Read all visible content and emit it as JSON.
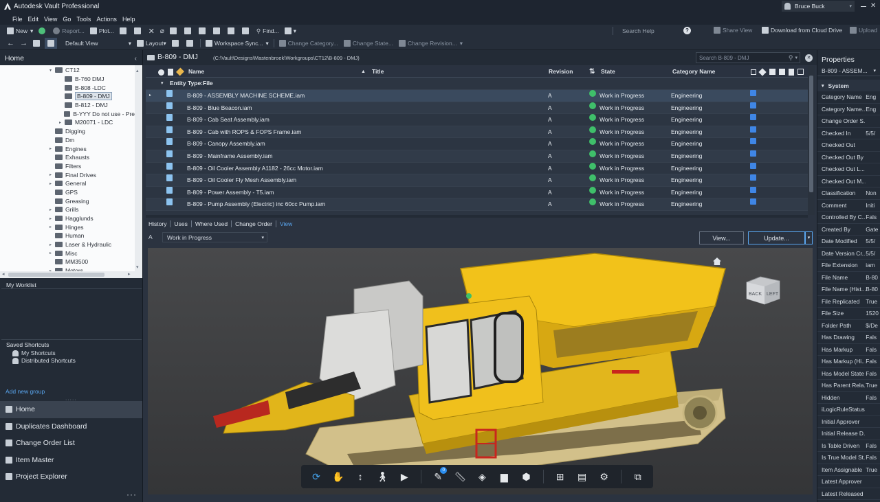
{
  "app": {
    "title": "Autodesk Vault Professional",
    "user": "Bruce Buck"
  },
  "menu": [
    "File",
    "Edit",
    "View",
    "Go",
    "Tools",
    "Actions",
    "Help"
  ],
  "toolbar1": {
    "new": "New",
    "report": "Report...",
    "plot": "Plot...",
    "find": "Find...",
    "search_help": "Search Help",
    "share_view": "Share View",
    "download_cloud": "Download from Cloud Drive",
    "upload": "Upload"
  },
  "toolbar2": {
    "default_view": "Default View",
    "layout": "Layout",
    "workspace_sync": "Workspace Sync...",
    "change_category": "Change Category...",
    "change_state": "Change State...",
    "change_revision": "Change Revision..."
  },
  "left": {
    "home": "Home",
    "tree": [
      {
        "label": "CT12",
        "level": 1,
        "expander": "▾"
      },
      {
        "label": "B-760 DMJ",
        "level": 2,
        "expander": ""
      },
      {
        "label": "B-808 -LDC",
        "level": 2,
        "expander": ""
      },
      {
        "label": "B-809 - DMJ",
        "level": 2,
        "expander": "",
        "selected": true
      },
      {
        "label": "B-812 - DMJ",
        "level": 2,
        "expander": ""
      },
      {
        "label": "B-YYY Do not use - Pre",
        "level": 2,
        "expander": ""
      },
      {
        "label": "M20071 - LDC",
        "level": 2,
        "expander": "▸"
      },
      {
        "label": "Digging",
        "level": 1,
        "expander": ""
      },
      {
        "label": "Dm",
        "level": 1,
        "expander": ""
      },
      {
        "label": "Engines",
        "level": 1,
        "expander": "▸"
      },
      {
        "label": "Exhausts",
        "level": 1,
        "expander": ""
      },
      {
        "label": "Filters",
        "level": 1,
        "expander": ""
      },
      {
        "label": "Final Drives",
        "level": 1,
        "expander": "▸"
      },
      {
        "label": "General",
        "level": 1,
        "expander": "▸"
      },
      {
        "label": "GPS",
        "level": 1,
        "expander": ""
      },
      {
        "label": "Greasing",
        "level": 1,
        "expander": ""
      },
      {
        "label": "Grills",
        "level": 1,
        "expander": "▸"
      },
      {
        "label": "Hagglunds",
        "level": 1,
        "expander": "▸"
      },
      {
        "label": "Hinges",
        "level": 1,
        "expander": "▸"
      },
      {
        "label": "Human",
        "level": 1,
        "expander": ""
      },
      {
        "label": "Laser & Hydraulic",
        "level": 1,
        "expander": "▸"
      },
      {
        "label": "Misc",
        "level": 1,
        "expander": "▸"
      },
      {
        "label": "MM3500",
        "level": 1,
        "expander": ""
      },
      {
        "label": "Motors",
        "level": 1,
        "expander": "▸"
      }
    ],
    "worklist": "My Worklist",
    "saved_shortcuts": "Saved Shortcuts",
    "shortcuts": [
      "My Shortcuts",
      "Distributed Shortcuts"
    ],
    "add_group": "Add new group",
    "nav": [
      "Home",
      "Duplicates Dashboard",
      "Change Order List",
      "Item Master",
      "Project Explorer"
    ]
  },
  "main": {
    "folder": "B-809 - DMJ",
    "path": "(C:\\Vault\\Designs\\Mastenbroek\\Workgroups\\CT12\\B-809 - DMJ)",
    "search_placeholder": "Search B-809 - DMJ",
    "columns": {
      "name": "Name",
      "title": "Title",
      "revision": "Revision",
      "state": "State",
      "category": "Category Name"
    },
    "group": "Entity Type:File",
    "rows": [
      {
        "name": "B-809 - ASSEMBLY MACHINE SCHEME.iam",
        "rev": "A",
        "state": "Work in Progress",
        "cat": "Engineering"
      },
      {
        "name": "B-809 - Blue Beacon.iam",
        "rev": "A",
        "state": "Work in Progress",
        "cat": "Engineering"
      },
      {
        "name": "B-809 - Cab Seat Assembly.iam",
        "rev": "A",
        "state": "Work in Progress",
        "cat": "Engineering"
      },
      {
        "name": "B-809 - Cab with ROPS & FOPS Frame.iam",
        "rev": "A",
        "state": "Work in Progress",
        "cat": "Engineering"
      },
      {
        "name": "B-809 - Canopy Assembly.iam",
        "rev": "A",
        "state": "Work in Progress",
        "cat": "Engineering"
      },
      {
        "name": "B-809 - Mainframe Assembly.iam",
        "rev": "A",
        "state": "Work in Progress",
        "cat": "Engineering"
      },
      {
        "name": "B-809 - Oil Cooler Assembly A1182 - 26cc Motor.iam",
        "rev": "A",
        "state": "Work in Progress",
        "cat": "Engineering"
      },
      {
        "name": "B-809 - Oil Cooler Fly Mesh Assembly.iam",
        "rev": "A",
        "state": "Work in Progress",
        "cat": "Engineering"
      },
      {
        "name": "B-809 - Power Assembly - T5.iam",
        "rev": "A",
        "state": "Work in Progress",
        "cat": "Engineering"
      },
      {
        "name": "B-809 - Pump Assembly (Electric)  inc 60cc Pump.iam",
        "rev": "A",
        "state": "Work in Progress",
        "cat": "Engineering"
      }
    ],
    "tabs": [
      "History",
      "Uses",
      "Where Used",
      "Change Order",
      "View"
    ],
    "rev_select": "A",
    "state_select": "Work in Progress",
    "view_btn": "View...",
    "update_btn": "Update...",
    "viewcube": {
      "back": "BACK",
      "left": "LEFT"
    },
    "badge": "0"
  },
  "properties": {
    "title": "Properties",
    "selected": "B-809 - ASSEM...",
    "section": "System",
    "rows": [
      {
        "k": "Category Name",
        "v": "Eng"
      },
      {
        "k": "Category Name...",
        "v": "Eng"
      },
      {
        "k": "Change Order S...",
        "v": ""
      },
      {
        "k": "Checked In",
        "v": "5/5/"
      },
      {
        "k": "Checked Out",
        "v": ""
      },
      {
        "k": "Checked Out By",
        "v": ""
      },
      {
        "k": "Checked Out L...",
        "v": ""
      },
      {
        "k": "Checked Out M...",
        "v": ""
      },
      {
        "k": "Classification",
        "v": "Non"
      },
      {
        "k": "Comment",
        "v": "Initi"
      },
      {
        "k": "Controlled By C...",
        "v": "Fals"
      },
      {
        "k": "Created By",
        "v": "Gate"
      },
      {
        "k": "Date Modified",
        "v": "5/5/"
      },
      {
        "k": "Date Version Cr...",
        "v": "5/5/"
      },
      {
        "k": "File Extension",
        "v": "iam"
      },
      {
        "k": "File Name",
        "v": "B-80"
      },
      {
        "k": "File Name (Hist...",
        "v": "B-80"
      },
      {
        "k": "File Replicated",
        "v": "True"
      },
      {
        "k": "File Size",
        "v": "1520"
      },
      {
        "k": "Folder Path",
        "v": "$/De"
      },
      {
        "k": "Has Drawing",
        "v": "Fals"
      },
      {
        "k": "Has Markup",
        "v": "Fals"
      },
      {
        "k": "Has Markup (Hi...",
        "v": "Fals"
      },
      {
        "k": "Has Model State",
        "v": "Fals"
      },
      {
        "k": "Has Parent Rela...",
        "v": "True"
      },
      {
        "k": "Hidden",
        "v": "Fals"
      },
      {
        "k": "iLogicRuleStatus",
        "v": ""
      },
      {
        "k": "Initial Approver",
        "v": ""
      },
      {
        "k": "Initial Release D...",
        "v": ""
      },
      {
        "k": "Is Table Driven",
        "v": "Fals"
      },
      {
        "k": "Is True Model St...",
        "v": "Fals"
      },
      {
        "k": "Item Assignable",
        "v": "True"
      },
      {
        "k": "Latest Approver",
        "v": ""
      },
      {
        "k": "Latest Released",
        "v": ""
      }
    ]
  }
}
